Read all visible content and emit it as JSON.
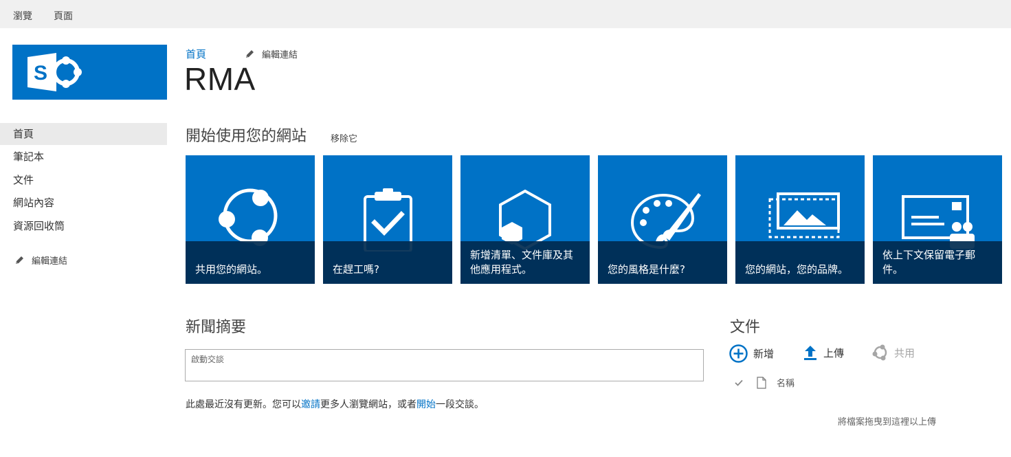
{
  "ribbon": {
    "tabs": [
      "瀏覽",
      "頁面"
    ]
  },
  "logo": {
    "name": "sharepoint-logo"
  },
  "quick_launch": {
    "items": [
      {
        "label": "首頁",
        "selected": true
      },
      {
        "label": "筆記本",
        "selected": false
      },
      {
        "label": "文件",
        "selected": false
      },
      {
        "label": "網站內容",
        "selected": false
      },
      {
        "label": "資源回收筒",
        "selected": false
      }
    ],
    "edit_links": "編輯連結"
  },
  "header": {
    "breadcrumb": "首頁",
    "edit_links": "編輯連結",
    "title": "RMA"
  },
  "getting_started": {
    "heading": "開始使用您的網站",
    "remove": "移除它",
    "tiles": [
      {
        "icon": "share-icon",
        "text": "共用您的網站。"
      },
      {
        "icon": "clipboard-check-icon",
        "text": "在趕工嗎?"
      },
      {
        "icon": "app-hexagon-icon",
        "text": "新增清單、文件庫及其他應用程式。"
      },
      {
        "icon": "palette-icon",
        "text": "您的風格是什麼?"
      },
      {
        "icon": "image-icon",
        "text": "您的網站，您的品牌。"
      },
      {
        "icon": "email-contact-icon",
        "text": "依上下文保留電子郵件。"
      }
    ],
    "tile_color": "#0072c6",
    "tile_bar_color": "#002a4f"
  },
  "newsfeed": {
    "heading": "新聞摘要",
    "input_placeholder": "啟動交談",
    "message": {
      "part1": "此處最近沒有更新。您可以",
      "link1": "邀請",
      "part2": "更多人瀏覽網站，或者",
      "link2": "開始",
      "part3": "一段交談。"
    }
  },
  "documents": {
    "heading": "文件",
    "buttons": {
      "new": "新增",
      "upload": "上傳",
      "share": "共用"
    },
    "column_name": "名稱",
    "drag_hint": "將檔案拖曳到這裡以上傳"
  },
  "colors": {
    "accent": "#0072c6",
    "disabled": "#a6a6a6"
  }
}
